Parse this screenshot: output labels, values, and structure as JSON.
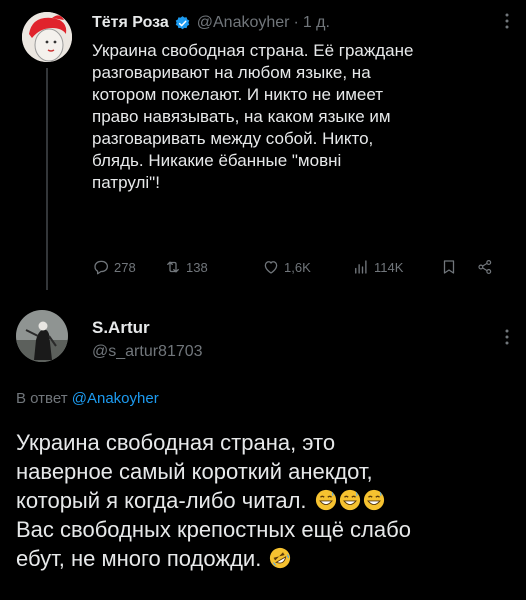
{
  "tweet_main": {
    "author_name": "Тётя Роза",
    "verified": true,
    "handle": "@Anakoyher",
    "separator": "·",
    "time": "1 д.",
    "text": "Украина свободная страна. Её граждане\nразговаривают на любом языке, на\nкотором пожелают. И никто не имеет\nправо навязывать, на каком языке им\nразговаривать между собой. Никто,\nблядь. Никакие ёбанные \"мовні\nпатрулі\"!",
    "replies": "278",
    "retweets": "138",
    "likes": "1,6K",
    "views": "114K",
    "accent_color": "#1d9bf0"
  },
  "tweet_reply": {
    "author_name": "S.Artur",
    "handle": "@s_artur81703",
    "reply_prefix": "В ответ",
    "reply_mention": "@Anakoyher",
    "text_line1": "Украина свободная страна, это",
    "text_line2": "наверное самый короткий анекдот,",
    "text_line3": "который я когда-либо читал.",
    "text_line4": "Вас свободных крепостных ещё слабо",
    "text_line5": "ебут, не много подожди.",
    "emoji_sweat_smile": "😅",
    "emoji_rofl": "🤣"
  },
  "icons": {
    "more": "more-dots-icon",
    "reply": "reply-icon",
    "retweet": "retweet-icon",
    "like": "heart-icon",
    "views": "views-icon",
    "bookmark": "bookmark-icon",
    "share": "share-icon"
  }
}
